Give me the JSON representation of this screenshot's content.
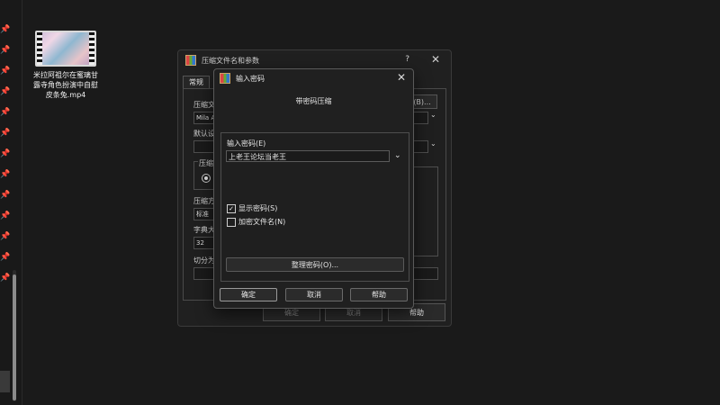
{
  "desktop": {
    "file": {
      "name": "米拉阿祖尔在蜜璃甘露寺角色扮演中自慰 皮条兔.mp4"
    }
  },
  "back_dialog": {
    "title": "压缩文件名和参数",
    "help_glyph": "?",
    "close_glyph": "✕",
    "tab_general": "常规",
    "label_archive_name": "压缩文",
    "archive_name_value": "Mila A",
    "label_default": "默认设",
    "label_compress_format": "压缩",
    "label_compress_method": "压缩方",
    "compress_method_value": "标准",
    "label_dict_size": "字典大",
    "dict_size_value": "32",
    "label_split": "切分为",
    "browse_button": "(B)...",
    "ok_button": "确定",
    "cancel_button": "取消",
    "help_button": "帮助"
  },
  "password_dialog": {
    "title": "输入密码",
    "close_glyph": "✕",
    "subtitle": "带密码压缩",
    "label_enter_password": "输入密码(E)",
    "password_value": "上老王论坛当老王",
    "show_password_label": "显示密码(S)",
    "show_password_checked": true,
    "encrypt_filenames_label": "加密文件名(N)",
    "encrypt_filenames_checked": false,
    "organize_button": "整理密码(O)...",
    "ok_button": "确定",
    "cancel_button": "取消",
    "help_button": "帮助"
  },
  "icons": {
    "pin": "📌",
    "chevron": "⌄",
    "check": "✓"
  }
}
